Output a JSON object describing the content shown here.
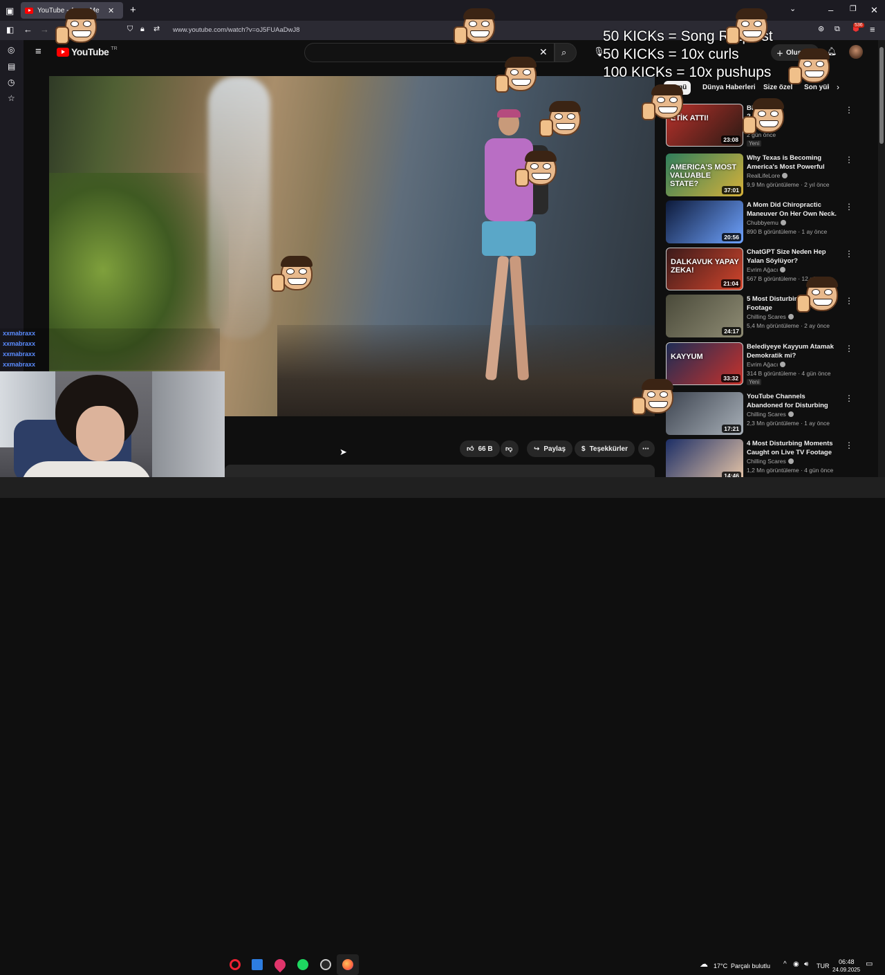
{
  "browser": {
    "tab_title": "YouTube - Ayme Me",
    "url": "www.youtube.com/watch?v=oJ5FUAaDwJ8",
    "badge_count": "536"
  },
  "youtube": {
    "logo_text": "YouTube",
    "logo_region": "TR",
    "search_placeholder": "",
    "create_label": "Oluştur",
    "chips": [
      "Tümü",
      "Dünya Haberleri",
      "Size özel",
      "Son yüklenenler"
    ]
  },
  "overlay": {
    "kick_lines": [
      "50 KICKs = Song Request",
      "50 KICKs = 10x curls",
      "100 KICKs = 10x pushups"
    ]
  },
  "recommendations": [
    {
      "title": "Bir \"Amele",
      "title_line2": "?",
      "channel": "",
      "meta": "2 gün önce",
      "duration": "23:08",
      "badge": "Yeni",
      "thumb_text": "ETİK ATTI!",
      "colors": [
        "#b9312b",
        "#2a1a14"
      ]
    },
    {
      "title": "Why Texas is Becoming America's Most Powerful State",
      "channel": "RealLifeLore",
      "meta": "9,9 Mn görüntüleme · 2 yıl önce",
      "duration": "37:01",
      "badge": "",
      "thumb_text": "AMERICA'S MOST VALUABLE STATE?",
      "colors": [
        "#2f7e5c",
        "#d6b13a"
      ]
    },
    {
      "title": "A Mom Did Chiropractic Maneuver On Her Own Neck. ...",
      "channel": "Chubbyemu",
      "meta": "890 B görüntüleme · 1 ay önce",
      "duration": "20:56",
      "badge": "",
      "thumb_text": "",
      "colors": [
        "#0d1a3a",
        "#6fa3ff"
      ]
    },
    {
      "title": "ChatGPT Size Neden Hep Yalan Söylüyor?",
      "channel": "Evrim Ağacı",
      "meta": "567 B görüntüleme · 12 gün önce",
      "duration": "21:04",
      "badge": "",
      "thumb_text": "DALKAVUK YAPAY ZEKA!",
      "colors": [
        "#3a1a1a",
        "#d2452c"
      ]
    },
    {
      "title": "5 Most Disturbing Found Footage",
      "channel": "Chilling Scares",
      "meta": "5,4 Mn görüntüleme · 2 ay önce",
      "duration": "24:17",
      "badge": "",
      "thumb_text": "",
      "colors": [
        "#4a4a3a",
        "#8f8c74"
      ]
    },
    {
      "title": "Belediyeye Kayyum Atamak Demokratik mi?",
      "channel": "Evrim Ağacı",
      "meta": "314 B görüntüleme · 4 gün önce",
      "duration": "33:32",
      "badge": "Yeni",
      "thumb_text": "KAYYUM",
      "colors": [
        "#1d2c55",
        "#c8322b"
      ]
    },
    {
      "title": "YouTube Channels Abandoned for Disturbing Reasons",
      "channel": "Chilling Scares",
      "meta": "2,3 Mn görüntüleme · 1 ay önce",
      "duration": "17:21",
      "badge": "",
      "thumb_text": "",
      "colors": [
        "#3d4450",
        "#a8b0b8"
      ]
    },
    {
      "title": "4 Most Disturbing Moments Caught on Live TV Footage",
      "channel": "Chilling Scares",
      "meta": "1,2 Mn görüntüleme · 4 gün önce",
      "duration": "14:46",
      "badge": "",
      "thumb_text": "",
      "colors": [
        "#1c2e66",
        "#e9c7a8"
      ]
    }
  ],
  "actions": {
    "likes": "66 B",
    "share": "Paylaş",
    "thanks": "Teşekkürler"
  },
  "chat": {
    "user": "xxmabraxx",
    "lines": 4
  },
  "taskbar": {
    "temperature": "17°C",
    "weather": "Parçalı bulutlu",
    "lang": "TUR",
    "time": "06:48",
    "date": "24.09.2025"
  }
}
